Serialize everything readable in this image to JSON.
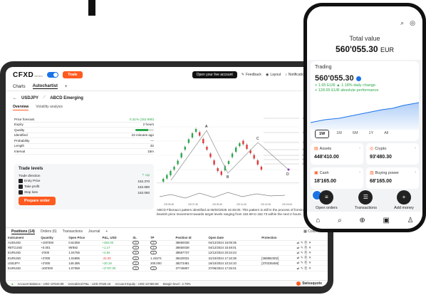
{
  "desktop": {
    "logo": "CFXD",
    "logo_sub": "demo",
    "trade_btn": "Trade",
    "open_live": "Open your live account",
    "feedback": "Feedback",
    "layout": "Layout",
    "notifications": "Notifications",
    "notif_count": "14",
    "tabs": [
      "Charts",
      "Autochartist",
      "+"
    ],
    "instrument": "USDJPY",
    "pattern": "ABCD Emerging",
    "subtabs": [
      "Overview",
      "Volatility analysis"
    ],
    "details": [
      {
        "k": "Price forecast",
        "v": "0.31% (152.690)"
      },
      {
        "k": "Expiry",
        "v": "2 hours"
      },
      {
        "k": "Quality",
        "v": ""
      },
      {
        "k": "Identified",
        "v": "23 minutes ago"
      },
      {
        "k": "Probability",
        "v": "—"
      },
      {
        "k": "Length",
        "v": "32"
      },
      {
        "k": "Interval",
        "v": "15m"
      }
    ],
    "trade_levels": {
      "title": "Trade levels",
      "direction_label": "Trade direction",
      "direction": "Up",
      "rows": [
        {
          "k": "Entry Price",
          "v": "152.370"
        },
        {
          "k": "Take profit",
          "v": "152.690"
        },
        {
          "k": "Stop loss",
          "v": "152.060"
        }
      ],
      "order_btn": "Prepare order"
    },
    "chart": {
      "point_labels": [
        "A",
        "B",
        "C",
        "D"
      ],
      "y_ticks": [
        "1.616",
        "1.272",
        "1.000",
        "0.786",
        "0.618",
        "0.500",
        "0.382"
      ],
      "x_ticks": [
        "2/5 05:30",
        "2/5 07:30",
        "2/5 09:30",
        "2/5 11:30",
        "2/5 13:30",
        "2/5 15:00"
      ]
    },
    "chart_description": "ABCD Fibonacci pattern identified at 05/02/2025 15:45:00. This pattern is still in the process of forming. Possible bearish price movement towards target levels ranging from 152.69 to 152.73 within the next 2 hours.",
    "panel_tabs": [
      "Positions (14)",
      "Orders (6)",
      "Transactions",
      "Journal",
      "+"
    ],
    "columns_label": "Columns",
    "table_headers": [
      "Instrument",
      "Quantity",
      "Open Price",
      "P&L, USD",
      "SL",
      "TP",
      "Position Id",
      "Open Date",
      "Protection"
    ],
    "rows": [
      [
        "AUDUSD",
        "+100'000",
        "0.62359",
        "+484.00",
        "+",
        "+",
        "38650038",
        "04/12/2024 16:09:35",
        ""
      ],
      [
        "#BTCUSD",
        "+0.001",
        "96'882",
        "+1.17",
        "+",
        "+",
        "38650038",
        "04/12/2024 15:48:01",
        ""
      ],
      [
        "EURUSD",
        "-2'000",
        "1.04755",
        "+4.94",
        "+",
        "+",
        "38587737",
        "12/12/2024 20:34:43",
        ""
      ],
      [
        "EURUSD",
        "+2'000",
        "1.04895",
        "-31.00",
        "+",
        "1.41574",
        "38420031",
        "31/10/2024 17:16:38",
        "[368882302]"
      ],
      [
        "USDJPY",
        "+2'000",
        "149.386",
        "+20.19",
        "+",
        "200.000",
        "38273481",
        "16/10/2024 10:34:10",
        "[370235459]"
      ],
      [
        "EURUSD",
        "-100'000",
        "1.07058",
        "+2'707.00",
        "+",
        "+",
        "37749807",
        "27/06/2024 17:25:01",
        ""
      ]
    ],
    "status": {
      "account_balance": "Account Balance : USD 10'943.99",
      "unrealized": "Unrealized P&L : USD 3'526.16",
      "equity": "Account Equity : USD 13'469.55",
      "margin": "Margin level : 4.79%",
      "brand": "Swissquote"
    }
  },
  "phone": {
    "total_label": "Total value",
    "total_value": "560'055.30",
    "total_ccy": "EUR",
    "trading_label": "Trading",
    "trading_value": "560'055.30",
    "daily_change": "+ 1.65 EUR",
    "daily_pct": "▲ 1.18% daily change",
    "abs_perf": "+ 128.65 EUR absolute performance",
    "periods": [
      "1W",
      "1M",
      "6M",
      "1Y",
      "All"
    ],
    "tiles": [
      {
        "label": "Assets",
        "value": "448'410.00"
      },
      {
        "label": "Crypto",
        "value": "93'480.30"
      },
      {
        "label": "Cash",
        "value": "18'165.00"
      },
      {
        "label": "Buying power",
        "value": "68'165.00"
      }
    ],
    "actions": [
      "Open orders",
      "Transactions",
      "Add money"
    ],
    "colors": {
      "accent": "#ff5a1f",
      "blue": "#1a73e8",
      "green": "#2aa84a"
    }
  }
}
